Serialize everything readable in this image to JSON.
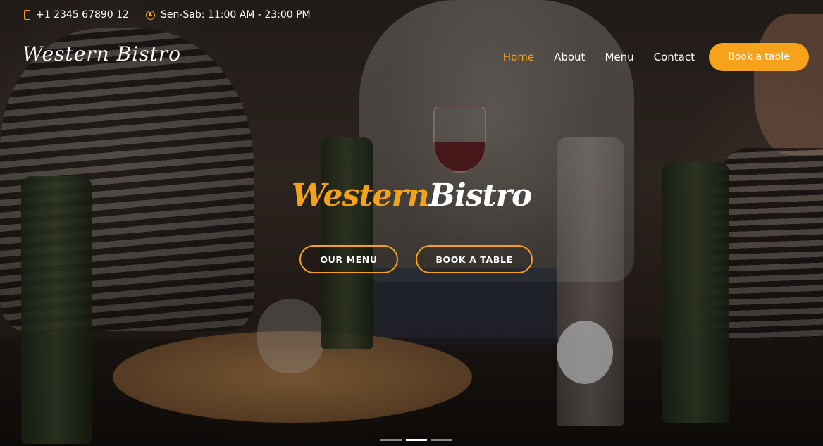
{
  "topbar": {
    "phone_icon": "phone-icon",
    "phone": "+1 2345 67890 12",
    "hours_icon": "clock-icon",
    "hours": "Sen-Sab: 11:00 AM - 23:00 PM"
  },
  "header": {
    "logo": "Western Bistro",
    "nav": [
      {
        "label": "Home",
        "active": true
      },
      {
        "label": "About",
        "active": false
      },
      {
        "label": "Menu",
        "active": false
      },
      {
        "label": "Contact",
        "active": false
      }
    ],
    "cta_label": "Book a table"
  },
  "hero": {
    "title_part1": "Western",
    "title_part2": "Bistro",
    "buttons": {
      "menu_label": "OUR MENU",
      "book_label": "BOOK A TABLE"
    }
  },
  "slider": {
    "slide_count": 3,
    "active_index": 1
  },
  "colors": {
    "accent": "#f5a21b",
    "text": "#ffffff"
  }
}
